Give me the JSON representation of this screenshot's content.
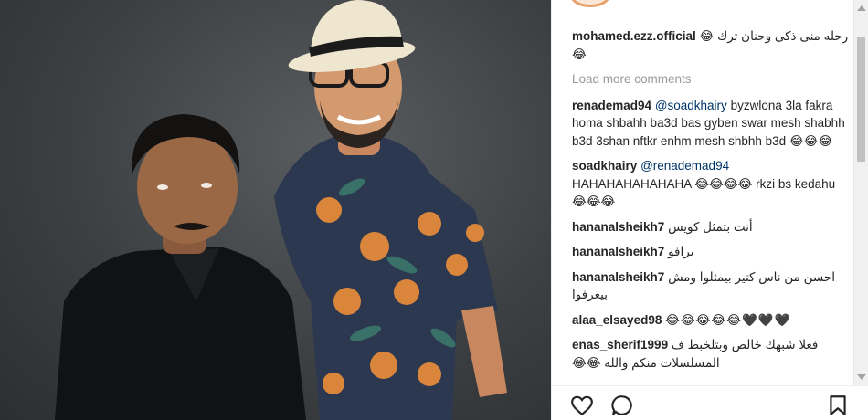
{
  "post": {
    "author": "mohamed.ezz.official",
    "caption": "رحله منى ذكى وحنان ترك 😂😂",
    "load_more": "Load more comments"
  },
  "comments": [
    {
      "user": "renademad94",
      "mention": "@soadkhairy",
      "text": " byzwlona 3la fakra homa shbahh ba3d bas gyben swar mesh shabhh b3d 3shan nftkr enhm mesh shbhh b3d 😂😂😂"
    },
    {
      "user": "soadkhairy",
      "mention": "@renademad94",
      "text": " HAHAHAHAHAHAHA 😂😂😂😂 rkzi bs kedahu😂😂😂"
    },
    {
      "user": "hananalsheikh7",
      "mention": "",
      "text": "أنت بتمثل كويس"
    },
    {
      "user": "hananalsheikh7",
      "mention": "",
      "text": "برافو"
    },
    {
      "user": "hananalsheikh7",
      "mention": "",
      "text": "احسن من ناس كتير بيمثلوا ومش بيعرفوا"
    },
    {
      "user": "alaa_elsayed98",
      "mention": "",
      "text": "😂😂😂😂😂🖤🖤🖤"
    },
    {
      "user": "enas_sherif1999",
      "mention": "",
      "text": "فعلا شبهك خالص وبتلخبط ف المسلسلات منكم والله 😂😂"
    }
  ],
  "actions": {
    "like_icon": "heart-icon",
    "comment_icon": "comment-icon",
    "save_icon": "bookmark-icon"
  }
}
